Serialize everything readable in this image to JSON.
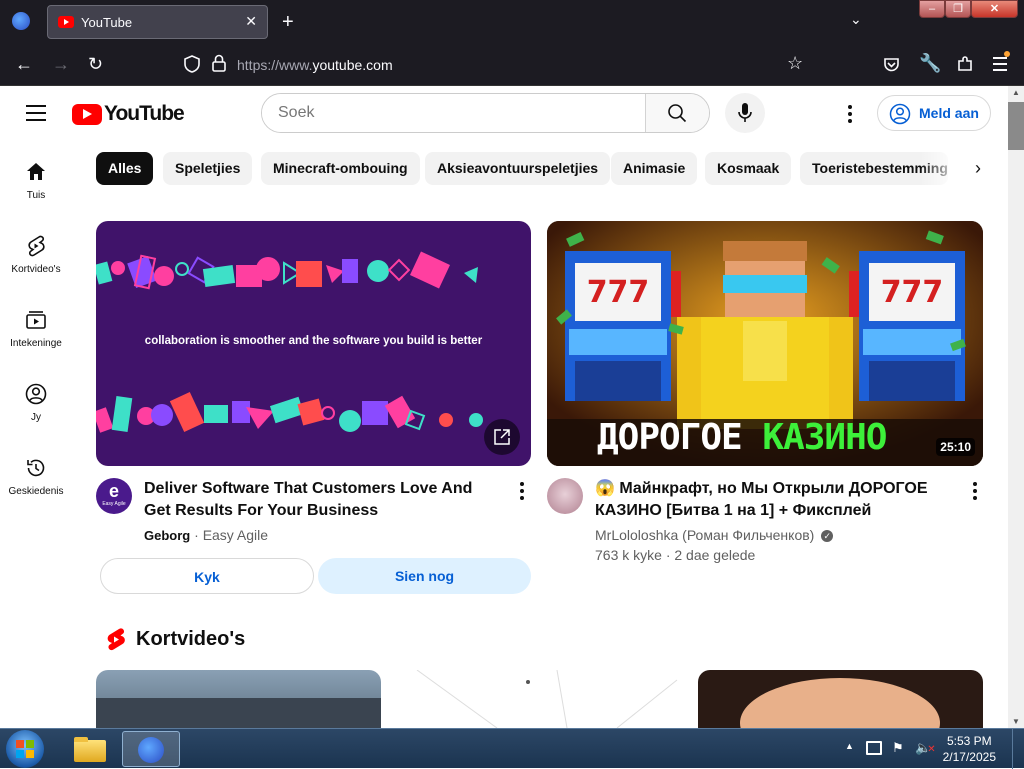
{
  "browser": {
    "tab_title": "YouTube",
    "url_prefix": "https://www.",
    "url_domain": "youtube.com"
  },
  "header": {
    "logo_text": "YouTube",
    "search_placeholder": "Soek",
    "sign_in": "Meld aan"
  },
  "guide": [
    {
      "label": "Tuis",
      "icon": "home-icon"
    },
    {
      "label": "Kortvideo's",
      "icon": "shorts-icon"
    },
    {
      "label": "Intekeninge",
      "icon": "subscriptions-icon"
    },
    {
      "label": "Jy",
      "icon": "you-icon"
    },
    {
      "label": "Geskiedenis",
      "icon": "history-icon"
    }
  ],
  "chips": [
    "Alles",
    "Speletjies",
    "Minecraft-ombouing",
    "Aksieavontuurspeletjies",
    "Animasie",
    "Kosmaak",
    "Toeristebestemming"
  ],
  "videos": [
    {
      "title": "Deliver Software That Customers Love And Get Results For Your Business",
      "ad_label": "Geborg",
      "channel": "Easy Agile",
      "thumb_text": "collaboration is smoother and the software you build is better",
      "avatar_text": "Easy Agile",
      "buttons": [
        "Kyk",
        "Sien nog"
      ]
    },
    {
      "title_line1": "😱 Майнкрафт, но Мы Открыли ДОРОГОЕ",
      "title_line2": "КАЗИНО [Битва 1 на 1] + Фикcплей",
      "channel": "MrLololoshka (Роман Фильченков)",
      "meta": "763 k kyke · 2 dae gelede",
      "duration": "25:10",
      "thumb_word1": "ДОРОГОЕ",
      "thumb_word2": "КАЗИНО",
      "slot_text": "777"
    }
  ],
  "shorts_heading": "Kortvideo's",
  "taskbar": {
    "time": "5:53 PM",
    "date": "2/17/2025"
  },
  "colors": {
    "brand_red": "#ff0000",
    "link_blue": "#065fd4",
    "chrome_dark": "#1c1b22"
  }
}
